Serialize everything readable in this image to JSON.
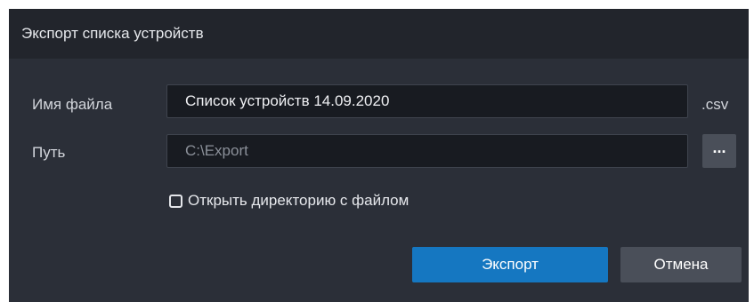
{
  "dialog": {
    "title": "Экспорт списка устройств"
  },
  "form": {
    "filename_label": "Имя файла",
    "filename_value": "Список устройств 14.09.2020",
    "extension": ".csv",
    "path_label": "Путь",
    "path_value": "C:\\Export",
    "browse_label": "...",
    "open_dir_label": "Открыть директорию с файлом",
    "open_dir_checked": false
  },
  "buttons": {
    "export_label": "Экспорт",
    "cancel_label": "Отмена"
  },
  "colors": {
    "primary": "#1577c1",
    "dialog_bg": "#2b2f38",
    "title_bg": "#22252c",
    "input_bg": "#181b21",
    "secondary_button": "#4a4f59"
  }
}
